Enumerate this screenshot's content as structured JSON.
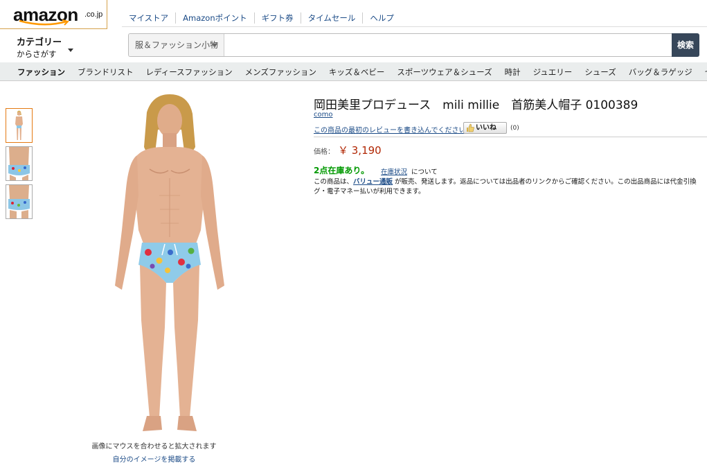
{
  "header": {
    "logo_text": "amazon",
    "logo_tld": ".co.jp",
    "topnav": [
      "マイストア",
      "Amazonポイント",
      "ギフト券",
      "タイムセール",
      "ヘルプ"
    ],
    "category_title": "カテゴリー",
    "category_sub": "からさがす",
    "search_dept": "服＆ファッション小物",
    "search_placeholder": "",
    "search_button": "検索"
  },
  "catnav": [
    "ファッション",
    "ブランドリスト",
    "レディースファッション",
    "メンズファッション",
    "キッズ＆ベビー",
    "スポーツウェア＆シューズ",
    "時計",
    "ジュエリー",
    "シューズ",
    "バッグ＆ラゲッジ",
    "セール"
  ],
  "gallery": {
    "caption": "画像にマウスを合わせると拡大されます",
    "upload_link": "自分のイメージを掲載する"
  },
  "product": {
    "title": "岡田美里プロデュース　mili millie　首筋美人帽子 0100389",
    "brand": "como",
    "review_link": "この商品の最初のレビューを書き込んでください。",
    "like_label": "いいね",
    "like_count": "(0)",
    "price_label": "価格：",
    "price": "￥ 3,190",
    "stock": "2点在庫あり。",
    "stock_link": "在庫状況",
    "stock_tail": "について",
    "ship_line1_pre": "この商品は、",
    "seller": "バリュー通販",
    "ship_line1_post": " が販売、発送します。返品については出品者のリンクからご確認ください。この出品商品には代金引換",
    "ship_line2": "グ・電子マネー払いが利用できます。"
  },
  "colors": {
    "accent": "#e47911",
    "link": "#1a4a86",
    "price": "#b12704",
    "stock": "#009900",
    "search_btn": "#37475a"
  }
}
